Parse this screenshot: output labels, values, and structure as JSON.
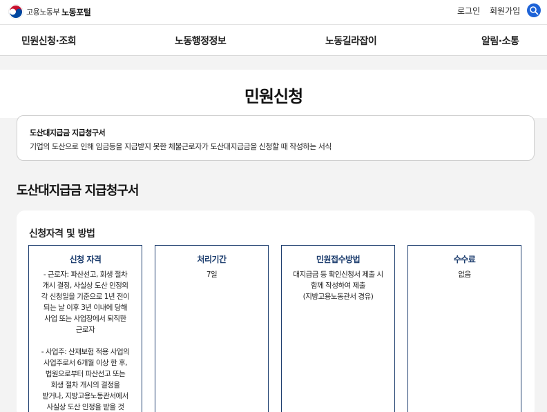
{
  "header": {
    "ministry": "고용노동부",
    "portal": "노동포털",
    "login": "로그인",
    "join": "회원가입",
    "search_icon": "search-icon",
    "search_color": "#1e63d7"
  },
  "nav": {
    "items": [
      {
        "label": "민원신청·조회"
      },
      {
        "label": "노동행정정보"
      },
      {
        "label": "노동길라잡이"
      },
      {
        "label": "알림·소통"
      }
    ]
  },
  "page": {
    "title": "민원신청"
  },
  "summary": {
    "title": "도산대지급금 지급청구서",
    "description": "기업의 도산으로 인해 임금등을 지급받지 못한 체불근로자가 도산대지급금을 신청할 때 작성하는 서식"
  },
  "form": {
    "title": "도산대지급금 지급청구서"
  },
  "section": {
    "title": "신청자격 및 방법",
    "boxes": [
      {
        "heading": "신청 자격",
        "paragraphs": [
          "- 근로자: 파산선고, 회생 절차\n개시 결정, 사실상 도산 인정의\n각 신청일을 기준으로 1년 전이\n되는 날 이후 3년 이내에 당해\n사업 또는 사업장에서 퇴직한\n근로자",
          "- 사업주: 산재보험 적용 사업의\n사업주로서 6개월 이상 한 후,\n법원으로부터 파산선고 또는\n회생 절차 개시의 결정을\n받거나, 지방고용노동관서에서\n사실상 도산 인정을 받을 것"
        ]
      },
      {
        "heading": "처리기간",
        "paragraphs": [
          "7일"
        ]
      },
      {
        "heading": "민원접수방법",
        "paragraphs": [
          "대지급금 등 확인신청서 제출 시\n함께 작성하여 제출\n(지방고용노동관서 경유)"
        ]
      },
      {
        "heading": "수수료",
        "paragraphs": [
          "없음"
        ]
      }
    ]
  },
  "colors": {
    "accent": "#1e63d7",
    "box_border": "#1c3d6e",
    "background": "#f3f3f3"
  }
}
